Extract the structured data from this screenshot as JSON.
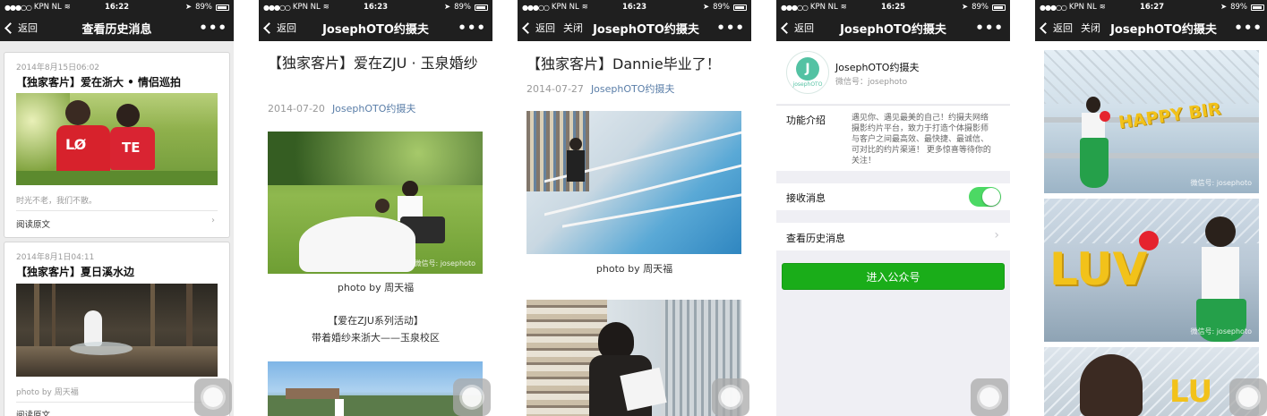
{
  "panels": [
    {
      "status": {
        "carrier": "KPN NL",
        "time": "16:22",
        "battery": "89%"
      },
      "nav": {
        "back": "返回",
        "title": "查看历史消息",
        "more": "•••"
      },
      "messages": [
        {
          "date": "2014年8月15日06:02",
          "title": "【独家客片】爱在浙大 • 情侣巡拍",
          "digest": "时光不老，我们不散。",
          "read_more": "阅读原文"
        },
        {
          "date": "2014年8月1日04:11",
          "title": "【独家客片】夏日溪水边",
          "digest": "photo by 周天福",
          "read_more": "阅读原文"
        }
      ]
    },
    {
      "status": {
        "carrier": "KPN NL",
        "time": "16:23",
        "battery": "89%"
      },
      "nav": {
        "back": "返回",
        "title": "JosephOTO约摄夫",
        "more": "•••"
      },
      "article": {
        "title": "【独家客片】爱在ZJU · 玉泉婚纱",
        "date": "2014-07-20",
        "author": "JosephOTO约摄夫",
        "watermark": "微信号: josephoto",
        "caption": "photo by 周天福",
        "body_line1": "【爱在ZJU系列活动】",
        "body_line2": "带着婚纱来浙大——玉泉校区"
      }
    },
    {
      "status": {
        "carrier": "KPN NL",
        "time": "16:23",
        "battery": "89%"
      },
      "nav": {
        "back": "返回",
        "close": "关闭",
        "title": "JosephOTO约摄夫",
        "more": "•••"
      },
      "article": {
        "title": "【独家客片】Dannie毕业了！",
        "date": "2014-07-27",
        "author": "JosephOTO约摄夫",
        "caption": "photo by 周天福"
      }
    },
    {
      "status": {
        "carrier": "KPN NL",
        "time": "16:25",
        "battery": "89%"
      },
      "nav": {
        "back": "返回",
        "title": "JosephOTO约摄夫",
        "more": "•••"
      },
      "profile": {
        "logo_text": "josephOTO",
        "name": "JosephOTO约摄夫",
        "wechat_id": "微信号：josephoto",
        "intro_label": "功能介绍",
        "intro_text": "遇见你、遇见最美的自己！约摄夫网络摄影约片平台，致力于打造个体摄影师与客户之间最高效、最快捷、最诚信、可对比的约片渠道！ 更多惊喜等待你的关注！",
        "receive_label": "接收消息",
        "receive_on": true,
        "history_label": "查看历史消息",
        "enter_button": "进入公众号"
      }
    },
    {
      "status": {
        "carrier": "KPN NL",
        "time": "16:27",
        "battery": "89%"
      },
      "nav": {
        "back": "返回",
        "close": "关闭",
        "title": "JosephOTO约摄夫",
        "more": "•••"
      },
      "watermark1": "微信号: josephoto",
      "watermark2": "微信号: josephoto"
    }
  ]
}
